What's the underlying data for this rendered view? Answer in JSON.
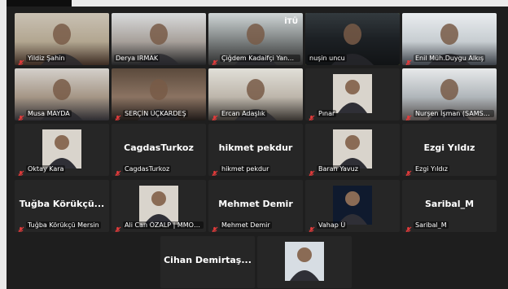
{
  "tiles": [
    {
      "label": "Yildiz Şahin",
      "muted": true,
      "kind": "video"
    },
    {
      "label": "Derya IRMAK",
      "muted": false,
      "kind": "video"
    },
    {
      "label": "Çiğdem Kadaifçi Yanmaz",
      "muted": true,
      "kind": "video",
      "overlay": "İTÜ"
    },
    {
      "label": "nuşin uncu",
      "muted": false,
      "kind": "video",
      "active": true
    },
    {
      "label": "Enil Müh.Duygu Alkış",
      "muted": true,
      "kind": "video"
    },
    {
      "label": "Musa MAYDA",
      "muted": true,
      "kind": "video"
    },
    {
      "label": "SERÇİN ÜÇKARDEŞ",
      "muted": true,
      "kind": "video"
    },
    {
      "label": "Ercan Adaşlık",
      "muted": true,
      "kind": "video"
    },
    {
      "label": "Pınar",
      "muted": true,
      "kind": "photo"
    },
    {
      "label": "Nurşen İşman (SAMSUN)",
      "muted": true,
      "kind": "video"
    },
    {
      "label": "Oktay Kara",
      "muted": true,
      "kind": "photo"
    },
    {
      "label": "CagdasTurkoz",
      "muted": true,
      "kind": "name",
      "name": "CagdasTurkoz"
    },
    {
      "label": "hikmet pekdur",
      "muted": true,
      "kind": "name",
      "name": "hikmet pekdur"
    },
    {
      "label": "Baran Yavuz",
      "muted": true,
      "kind": "photo"
    },
    {
      "label": "Ezgi Yıldız",
      "muted": true,
      "kind": "name",
      "name": "Ezgi Yıldız"
    },
    {
      "label": "Tuğba Körükçü Mersin",
      "muted": true,
      "kind": "name",
      "name": "Tuğba Körükçü..."
    },
    {
      "label": "Ali Can ÖZALP | MMO İstan...",
      "muted": true,
      "kind": "photo"
    },
    {
      "label": "Mehmet Demir",
      "muted": true,
      "kind": "name",
      "name": "Mehmet Demir"
    },
    {
      "label": "Vahap Ü",
      "muted": true,
      "kind": "photo"
    },
    {
      "label": "Saribal_M",
      "muted": true,
      "kind": "name",
      "name": "Saribal_M"
    },
    {
      "label": "",
      "muted": false,
      "kind": "name",
      "name": "Cihan  Demirtaş..."
    },
    {
      "label": "",
      "muted": false,
      "kind": "photo"
    }
  ]
}
